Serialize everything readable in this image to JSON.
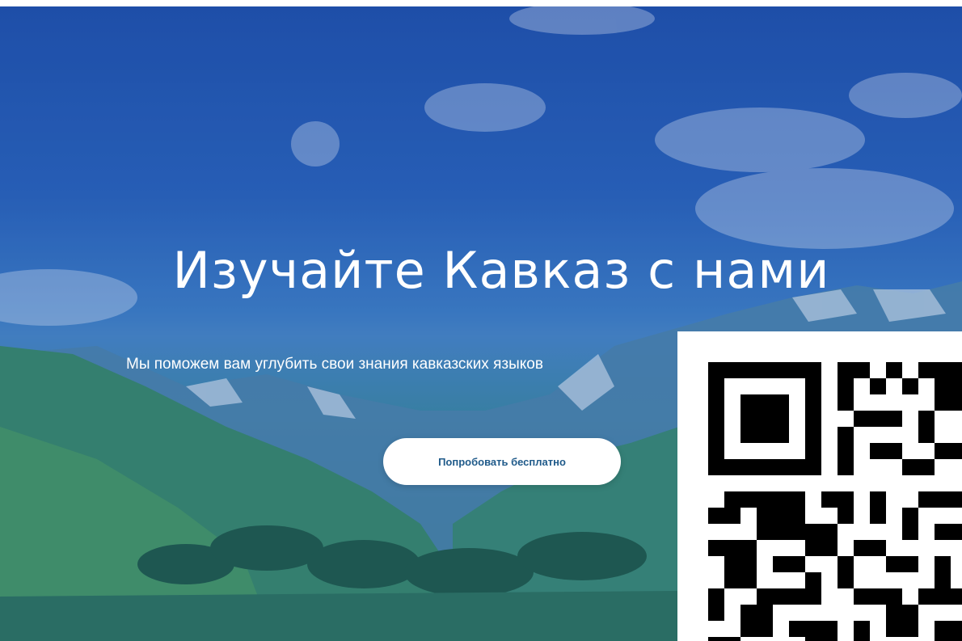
{
  "hero": {
    "title": "Изучайте Кавказ с нами",
    "subtitle": "Мы поможем вам углубить свои знания кавказских языков",
    "cta_label": "Попробовать бесплатно"
  },
  "colors": {
    "sky_top": "#1f4fa8",
    "valley": "#2f7e6e",
    "button_text": "#1f5a8a",
    "white": "#ffffff"
  },
  "icons": {
    "qr": "qr-code-icon"
  }
}
